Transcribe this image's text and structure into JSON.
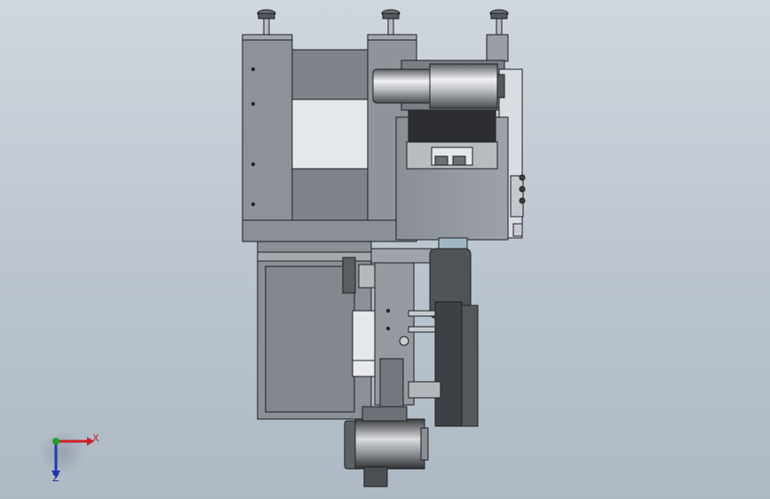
{
  "triad": {
    "x_label": "X",
    "z_label": "Z",
    "x_color": "#d11f26",
    "y_color": "#1fa22a",
    "z_color": "#2236b8"
  },
  "colors": {
    "background_top": "#cfd6de",
    "background_bottom": "#aeb9c4",
    "body_gray": "#8f939a",
    "body_dark": "#5f636a",
    "outline": "#1d1f22",
    "highlight": "#e9ebee"
  },
  "icons": [
    "coordinate-triad-icon"
  ]
}
